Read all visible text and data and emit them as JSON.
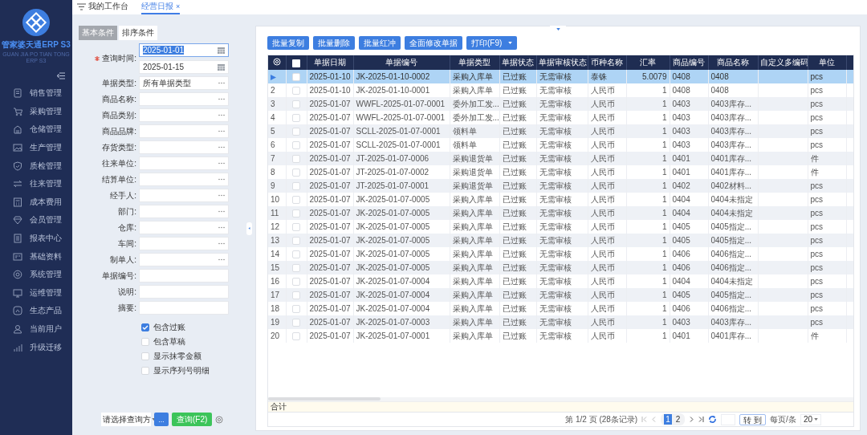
{
  "sidebar": {
    "logo_title": "管家婆天通ERP S3",
    "logo_subtitle": "GUAN JIA PO TIAN TONG ERP S3",
    "items": [
      {
        "label": "销售管理"
      },
      {
        "label": "采购管理"
      },
      {
        "label": "仓储管理"
      },
      {
        "label": "生产管理"
      },
      {
        "label": "质检管理"
      },
      {
        "label": "往来管理"
      },
      {
        "label": "成本费用"
      },
      {
        "label": "会员管理"
      },
      {
        "label": "报表中心"
      },
      {
        "label": "基础资料"
      },
      {
        "label": "系统管理"
      },
      {
        "label": "运维管理"
      },
      {
        "label": "生态产品"
      },
      {
        "label": "当前用户"
      },
      {
        "label": "升级迁移"
      }
    ]
  },
  "tabs": [
    {
      "label": "我的工作台",
      "selected": false
    },
    {
      "label": "经营日报",
      "selected": true,
      "close": "×"
    }
  ],
  "filter_tabs": [
    {
      "label": "基本条件",
      "selected": true
    },
    {
      "label": "排序条件",
      "selected": false
    }
  ],
  "form": {
    "fields": [
      {
        "label": "查询时间:",
        "required": true,
        "inputs": [
          {
            "kind": "date",
            "value": "2025-01-01",
            "focused": true
          },
          {
            "kind": "date",
            "value": "2025-01-15",
            "focused": false
          }
        ]
      },
      {
        "label": "单据类型:",
        "required": false,
        "inputs": [
          {
            "kind": "picker",
            "value": "所有单据类型"
          }
        ]
      },
      {
        "label": "商品名称:",
        "required": false,
        "inputs": [
          {
            "kind": "picker"
          }
        ]
      },
      {
        "label": "商品类别:",
        "required": false,
        "inputs": [
          {
            "kind": "picker"
          }
        ]
      },
      {
        "label": "商品品牌:",
        "required": false,
        "inputs": [
          {
            "kind": "picker"
          }
        ]
      },
      {
        "label": "存货类型:",
        "required": false,
        "inputs": [
          {
            "kind": "picker"
          }
        ]
      },
      {
        "label": "往来单位:",
        "required": false,
        "inputs": [
          {
            "kind": "picker"
          }
        ]
      },
      {
        "label": "结算单位:",
        "required": false,
        "inputs": [
          {
            "kind": "picker"
          }
        ]
      },
      {
        "label": "经手人:",
        "required": false,
        "inputs": [
          {
            "kind": "picker"
          }
        ]
      },
      {
        "label": "部门:",
        "required": false,
        "inputs": [
          {
            "kind": "picker"
          }
        ]
      },
      {
        "label": "仓库:",
        "required": false,
        "inputs": [
          {
            "kind": "picker"
          }
        ]
      },
      {
        "label": "车间:",
        "required": false,
        "inputs": [
          {
            "kind": "picker"
          }
        ]
      },
      {
        "label": "制单人:",
        "required": false,
        "inputs": [
          {
            "kind": "picker"
          }
        ]
      },
      {
        "label": "单据编号:",
        "required": false,
        "inputs": [
          {
            "kind": "text"
          }
        ]
      },
      {
        "label": "说明:",
        "required": false,
        "inputs": [
          {
            "kind": "text"
          }
        ]
      },
      {
        "label": "摘要:",
        "required": false,
        "inputs": [
          {
            "kind": "text"
          }
        ]
      }
    ],
    "checkboxes": [
      {
        "label": "包含过账",
        "checked": true
      },
      {
        "label": "包含草稿",
        "checked": false
      },
      {
        "label": "显示抹零金额",
        "checked": false
      },
      {
        "label": "显示序列号明细",
        "checked": false
      }
    ]
  },
  "header_toggle": {
    "expanded": false
  },
  "side_handle": {
    "expanded": true
  },
  "query_bar": {
    "scheme_placeholder": "请选择查询方",
    "more_button": "...",
    "query_button": "查询(F2)"
  },
  "toolbar": [
    {
      "label": "批量复制",
      "kind": "button"
    },
    {
      "label": "批量删除",
      "kind": "button"
    },
    {
      "label": "批量红冲",
      "kind": "button"
    },
    {
      "label": "全面修改单据",
      "kind": "button"
    },
    {
      "label": "打印(F9)",
      "kind": "dropdown"
    }
  ],
  "table": {
    "header_checked": false,
    "columns": [
      "单据日期",
      "单据编号",
      "单据类型",
      "单据状态",
      "单据审核状态",
      "币种名称",
      "汇率",
      "商品编号",
      "商品名称",
      "自定义多编码",
      "单位"
    ],
    "rows": [
      {
        "selected": true,
        "checked": false,
        "cells": [
          "2025-01-10",
          "JK-2025-01-10-0002",
          "采购入库单",
          "已过账",
          "无需审核",
          "泰铢",
          "5.0079",
          "0408",
          "0408",
          "",
          "pcs"
        ]
      },
      {
        "index": "2",
        "selected": false,
        "checked": false,
        "cells": [
          "2025-01-10",
          "JK-2025-01-10-0001",
          "采购入库单",
          "已过账",
          "无需审核",
          "人民币",
          "1",
          "0408",
          "0408",
          "",
          "pcs"
        ]
      },
      {
        "index": "3",
        "selected": false,
        "checked": false,
        "cells": [
          "2025-01-07",
          "WWFL-2025-01-07-0001",
          "委外加工发...",
          "已过账",
          "无需审核",
          "人民币",
          "1",
          "0403",
          "0403库存...",
          "",
          "pcs"
        ]
      },
      {
        "index": "4",
        "selected": false,
        "checked": false,
        "cells": [
          "2025-01-07",
          "WWFL-2025-01-07-0001",
          "委外加工发...",
          "已过账",
          "无需审核",
          "人民币",
          "1",
          "0403",
          "0403库存...",
          "",
          "pcs"
        ]
      },
      {
        "index": "5",
        "selected": false,
        "checked": false,
        "cells": [
          "2025-01-07",
          "SCLL-2025-01-07-0001",
          "领料单",
          "已过账",
          "无需审核",
          "人民币",
          "1",
          "0403",
          "0403库存...",
          "",
          "pcs"
        ]
      },
      {
        "index": "6",
        "selected": false,
        "checked": false,
        "cells": [
          "2025-01-07",
          "SCLL-2025-01-07-0001",
          "领料单",
          "已过账",
          "无需审核",
          "人民币",
          "1",
          "0403",
          "0403库存...",
          "",
          "pcs"
        ]
      },
      {
        "index": "7",
        "selected": false,
        "checked": false,
        "cells": [
          "2025-01-07",
          "JT-2025-01-07-0006",
          "采购退货单",
          "已过账",
          "无需审核",
          "人民币",
          "1",
          "0401",
          "0401库存...",
          "",
          "件"
        ]
      },
      {
        "index": "8",
        "selected": false,
        "checked": false,
        "cells": [
          "2025-01-07",
          "JT-2025-01-07-0002",
          "采购退货单",
          "已过账",
          "无需审核",
          "人民币",
          "1",
          "0401",
          "0401库存...",
          "",
          "件"
        ]
      },
      {
        "index": "9",
        "selected": false,
        "checked": false,
        "cells": [
          "2025-01-07",
          "JT-2025-01-07-0001",
          "采购退货单",
          "已过账",
          "无需审核",
          "人民币",
          "1",
          "0402",
          "0402材料...",
          "",
          "pcs"
        ]
      },
      {
        "index": "10",
        "selected": false,
        "checked": false,
        "cells": [
          "2025-01-07",
          "JK-2025-01-07-0005",
          "采购入库单",
          "已过账",
          "无需审核",
          "人民币",
          "1",
          "0404",
          "0404未指定",
          "",
          "pcs"
        ]
      },
      {
        "index": "11",
        "selected": false,
        "checked": false,
        "cells": [
          "2025-01-07",
          "JK-2025-01-07-0005",
          "采购入库单",
          "已过账",
          "无需审核",
          "人民币",
          "1",
          "0404",
          "0404未指定",
          "",
          "pcs"
        ]
      },
      {
        "index": "12",
        "selected": false,
        "checked": false,
        "cells": [
          "2025-01-07",
          "JK-2025-01-07-0005",
          "采购入库单",
          "已过账",
          "无需审核",
          "人民币",
          "1",
          "0405",
          "0405指定...",
          "",
          "pcs"
        ]
      },
      {
        "index": "13",
        "selected": false,
        "checked": false,
        "cells": [
          "2025-01-07",
          "JK-2025-01-07-0005",
          "采购入库单",
          "已过账",
          "无需审核",
          "人民币",
          "1",
          "0405",
          "0405指定...",
          "",
          "pcs"
        ]
      },
      {
        "index": "14",
        "selected": false,
        "checked": false,
        "cells": [
          "2025-01-07",
          "JK-2025-01-07-0005",
          "采购入库单",
          "已过账",
          "无需审核",
          "人民币",
          "1",
          "0406",
          "0406指定...",
          "",
          "pcs"
        ]
      },
      {
        "index": "15",
        "selected": false,
        "checked": false,
        "cells": [
          "2025-01-07",
          "JK-2025-01-07-0005",
          "采购入库单",
          "已过账",
          "无需审核",
          "人民币",
          "1",
          "0406",
          "0406指定...",
          "",
          "pcs"
        ]
      },
      {
        "index": "16",
        "selected": false,
        "checked": false,
        "cells": [
          "2025-01-07",
          "JK-2025-01-07-0004",
          "采购入库单",
          "已过账",
          "无需审核",
          "人民币",
          "1",
          "0404",
          "0404未指定",
          "",
          "pcs"
        ]
      },
      {
        "index": "17",
        "selected": false,
        "checked": false,
        "cells": [
          "2025-01-07",
          "JK-2025-01-07-0004",
          "采购入库单",
          "已过账",
          "无需审核",
          "人民币",
          "1",
          "0405",
          "0405指定...",
          "",
          "pcs"
        ]
      },
      {
        "index": "18",
        "selected": false,
        "checked": false,
        "cells": [
          "2025-01-07",
          "JK-2025-01-07-0004",
          "采购入库单",
          "已过账",
          "无需审核",
          "人民币",
          "1",
          "0406",
          "0406指定...",
          "",
          "pcs"
        ]
      },
      {
        "index": "19",
        "selected": false,
        "checked": false,
        "cells": [
          "2025-01-07",
          "JK-2025-01-07-0003",
          "采购入库单",
          "已过账",
          "无需审核",
          "人民币",
          "1",
          "0403",
          "0403库存...",
          "",
          "pcs"
        ]
      },
      {
        "index": "20",
        "selected": false,
        "checked": false,
        "cells": [
          "2025-01-07",
          "JK-2025-01-07-0001",
          "采购入库单",
          "已过账",
          "无需审核",
          "人民币",
          "1",
          "0401",
          "0401库存...",
          "",
          "件"
        ]
      }
    ],
    "total_label": "合计"
  },
  "pagination": {
    "summary": "第 1/2 页 (28条记录)",
    "pages": [
      {
        "label": "1",
        "selected": true
      },
      {
        "label": "2",
        "selected": false
      }
    ],
    "goto_button": "转 到",
    "per_page_label": "每页/条",
    "per_page": "20"
  }
}
